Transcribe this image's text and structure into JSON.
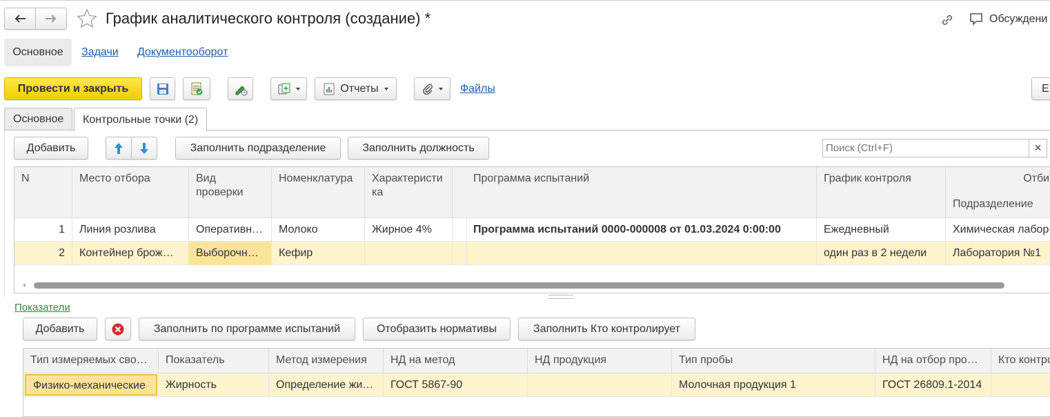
{
  "header": {
    "title": "График аналитического контроля (создание) *",
    "discussions_label": "Обсуждени"
  },
  "nav": {
    "main": "Основное",
    "tasks": "Задачи",
    "docflow": "Документооборот"
  },
  "toolbar": {
    "post_close": "Провести и закрыть",
    "reports": "Отчеты",
    "files": "Файлы",
    "right_label": "Е"
  },
  "tabs": [
    {
      "label": "Основное"
    },
    {
      "label": "Контрольные точки (2)"
    }
  ],
  "points_toolbar": {
    "add": "Добавить",
    "fill_department": "Заполнить подразделение",
    "fill_position": "Заполнить должность",
    "search_placeholder": "Поиск (Ctrl+F)",
    "clear": "×"
  },
  "points_table": {
    "columns": {
      "n": "N",
      "place": "Место отбора",
      "check_type": "Вид проверки",
      "nomenclature": "Номенклатура",
      "characteristic": "Характеристика",
      "program": "Программа испытаний",
      "schedule": "График контроля",
      "sampling": "Отбир",
      "department": "Подразделение"
    },
    "rows": [
      {
        "n": "1",
        "place": "Линия розлива",
        "check_type": "Оперативн…",
        "nomenclature": "Молоко",
        "characteristic": "Жирное 4%",
        "program": "Программа испытаний 0000-000008 от 01.03.2024 0:00:00",
        "schedule": "Ежедневный",
        "department": "Химическая лабор"
      },
      {
        "n": "2",
        "place": "Контейнер брож…",
        "check_type": "Выборочн…",
        "nomenclature": "Кефир",
        "characteristic": "",
        "program": "",
        "schedule": "один раз в 2 недели",
        "department": "Лаборатория №1"
      }
    ]
  },
  "indicators": {
    "title": "Показатели",
    "toolbar": {
      "add": "Добавить",
      "fill_by_program": "Заполнить по программе испытаний",
      "show_norms": "Отобразить нормативы",
      "fill_who_controls": "Заполнить Кто контролирует"
    },
    "columns": {
      "prop_type": "Тип измеряемых сво…",
      "indicator": "Показатель",
      "method": "Метод измерения",
      "nd_method": "НД на метод",
      "nd_product": "НД продукция",
      "sample_type": "Тип пробы",
      "nd_sampling": "НД на отбор про…",
      "who_controls": "Кто контро"
    },
    "rows": [
      {
        "prop_type": "Физико-механические",
        "indicator": "Жирность",
        "method": "Определение жи…",
        "nd_method": "ГОСТ 5867-90",
        "nd_product": "",
        "sample_type": "Молочная продукция 1",
        "nd_sampling": "ГОСТ 26809.1-2014",
        "who_controls": ""
      }
    ]
  },
  "colors": {
    "primary_button": "#f5d418",
    "selected_row": "#fdf3cc",
    "selected_cell": "#fbe49a",
    "link": "#1b5fb0",
    "section_link": "#2e8b3a"
  }
}
